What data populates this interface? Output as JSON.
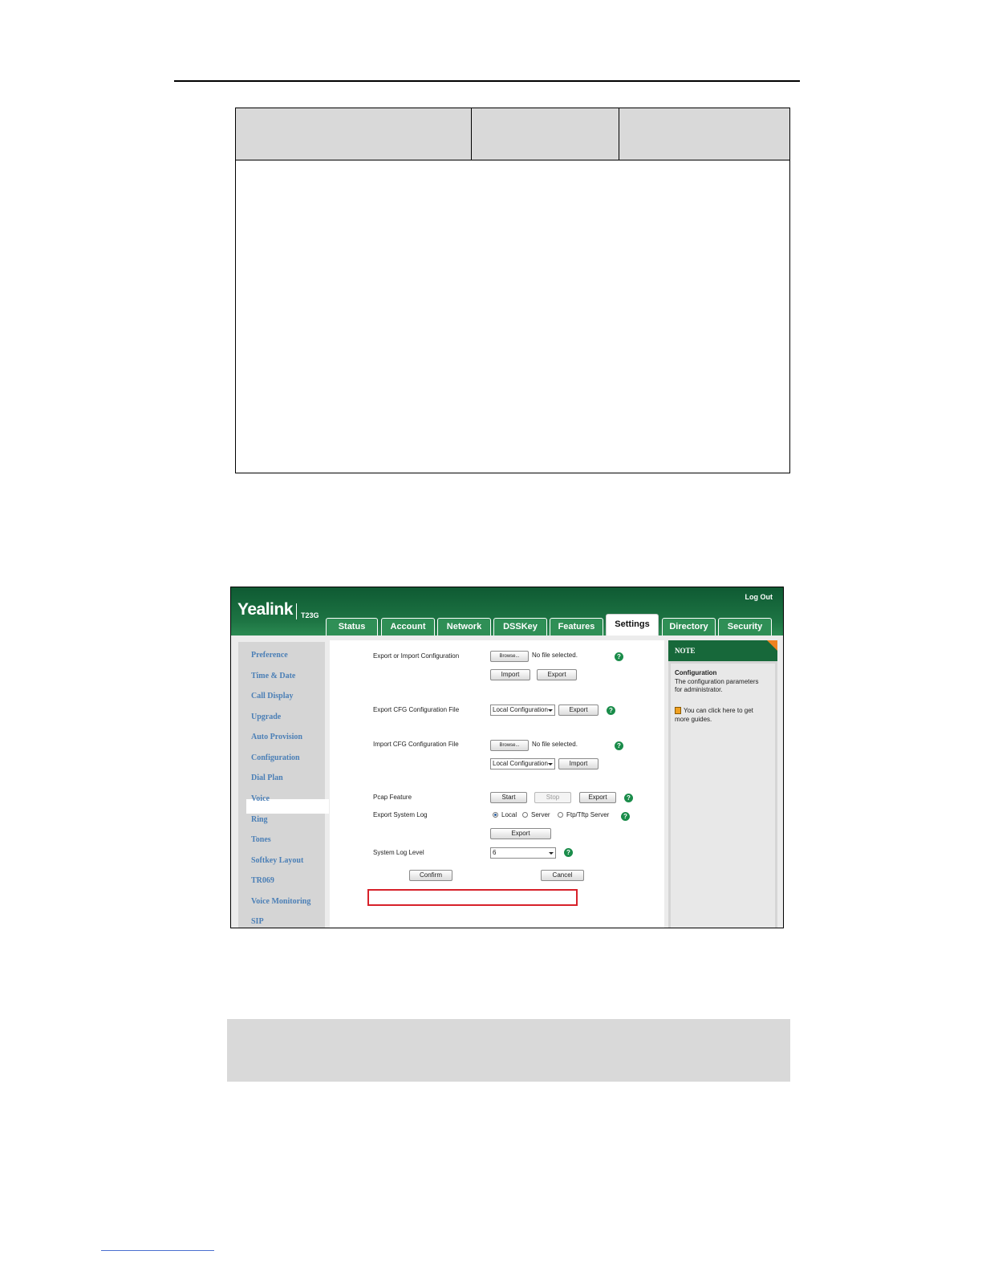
{
  "app": {
    "logo": "Yealink",
    "model": "T23G",
    "logout": "Log Out"
  },
  "tabs": [
    "Status",
    "Account",
    "Network",
    "DSSKey",
    "Features",
    "Settings",
    "Directory",
    "Security"
  ],
  "active_tab": "Settings",
  "sidebar": {
    "items": [
      "Preference",
      "Time & Date",
      "Call Display",
      "Upgrade",
      "Auto Provision",
      "Configuration",
      "Dial Plan",
      "Voice",
      "Ring",
      "Tones",
      "Softkey Layout",
      "TR069",
      "Voice Monitoring",
      "SIP"
    ],
    "active": "Configuration"
  },
  "form": {
    "export_import_label": "Export or Import Configuration",
    "browse_label": "Browse...",
    "no_file": "No file selected.",
    "import_label": "Import",
    "export_label": "Export",
    "export_cfg_label": "Export CFG Configuration File",
    "local_config": "Local Configuration",
    "import_cfg_label": "Import CFG Configuration File",
    "pcap_label": "Pcap Feature",
    "start_label": "Start",
    "stop_label": "Stop",
    "export_log_label": "Export System Log",
    "radio_local": "Local",
    "radio_server": "Server",
    "radio_ftp": "Ftp/Tftp Server",
    "log_level_label": "System Log Level",
    "log_level_value": "6",
    "confirm_label": "Confirm",
    "cancel_label": "Cancel"
  },
  "note": {
    "title": "NOTE",
    "heading": "Configuration",
    "line1": "The configuration parameters",
    "line2": "for administrator.",
    "hint1": "You can click here to get",
    "hint2": "more guides."
  },
  "colors": {
    "header_green": "#1d7443",
    "nav_link": "#4b7fb6",
    "highlight_red": "#d7212a",
    "help_green": "#1a8c4a"
  }
}
